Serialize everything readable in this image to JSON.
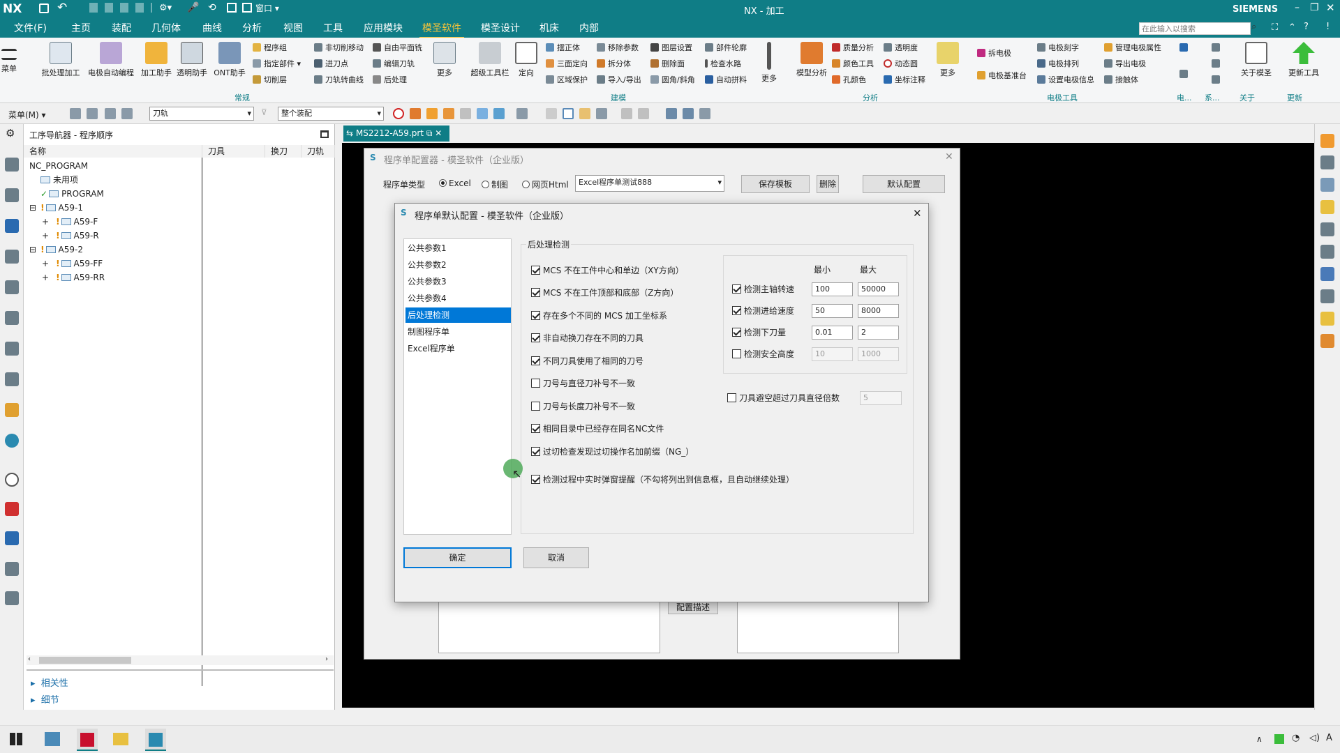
{
  "titlebar": {
    "logo": "NX",
    "title": "NX - 加工",
    "brand": "SIEMENS"
  },
  "menu": {
    "items": [
      "文件(F)",
      "主页",
      "装配",
      "几何体",
      "曲线",
      "分析",
      "视图",
      "工具",
      "应用模块",
      "模圣软件",
      "模圣设计",
      "机床",
      "内部"
    ],
    "active": "模圣软件",
    "search_placeholder": "在此输入以搜索"
  },
  "ribbon": {
    "big": [
      "批处理加工",
      "电极自动编程",
      "加工助手",
      "透明助手",
      "ONT助手"
    ],
    "left_small": [
      [
        "程序组",
        "非切削移动",
        "自由平面铣"
      ],
      [
        "指定部件",
        "进刀点",
        "编辑刀轨"
      ],
      [
        "切削层",
        "刀轨转曲线",
        "后处理"
      ]
    ],
    "mid_small": [
      [
        "摆正体",
        "移除参数",
        "图层设置",
        "部件轮廓"
      ],
      [
        "三面定向",
        "拆分体",
        "删除面",
        "检查水路"
      ],
      [
        "区域保护",
        "导入/导出",
        "圆角/斜角",
        "自动拼料"
      ]
    ],
    "mid_big": [
      "更多",
      "超级工具栏",
      "定向"
    ],
    "analysis_big": "模型分析",
    "analysis_small": [
      [
        "质量分析",
        "透明度"
      ],
      [
        "颜色工具",
        "动态圆"
      ],
      [
        "孔颜色",
        "坐标注释"
      ]
    ],
    "electrode_big": "拆电极",
    "electrode_base": "电极基准台",
    "electrode_small": [
      [
        "电极刻字",
        "管理电极属性"
      ],
      [
        "电极排列",
        "导出电极"
      ],
      [
        "设置电极信息",
        "接触体"
      ]
    ],
    "extra": [
      "关于模圣",
      "更新工具"
    ],
    "groups": [
      "常规",
      "建模",
      "分析",
      "电极工具",
      "电...",
      "系...",
      "关于",
      "更新"
    ],
    "more": "更多",
    "menu_btn": "菜单"
  },
  "toolbar2": {
    "menu": "菜单(M)",
    "filter": "刀轨",
    "assembly": "整个装配"
  },
  "nav": {
    "title": "工序导航器 - 程序顺序",
    "cols": [
      "名称",
      "刀具",
      "换刀",
      "刀轨"
    ],
    "tree": [
      {
        "label": "NC_PROGRAM",
        "level": 0
      },
      {
        "label": "未用项",
        "level": 1
      },
      {
        "label": "PROGRAM",
        "level": 1
      },
      {
        "label": "A59-1",
        "level": 1
      },
      {
        "label": "A59-F",
        "level": 2
      },
      {
        "label": "A59-R",
        "level": 2
      },
      {
        "label": "A59-2",
        "level": 1
      },
      {
        "label": "A59-FF",
        "level": 2
      },
      {
        "label": "A59-RR",
        "level": 2
      }
    ],
    "bottom": [
      "相关性",
      "细节"
    ]
  },
  "tab": {
    "label": "MS2212-A59.prt"
  },
  "cfg": {
    "title": "程序单配置器 - 模圣软件（企业版）",
    "type_label": "程序单类型",
    "radios": [
      "Excel",
      "制图",
      "网页Html"
    ],
    "selected": "Excel",
    "template": "Excel程序单测试888",
    "buttons": [
      "保存模板",
      "删除",
      "默认配置"
    ],
    "desc_btn": "配置描述"
  },
  "dlg": {
    "title": "程序单默认配置 - 模圣软件（企业版）",
    "list": [
      "公共参数1",
      "公共参数2",
      "公共参数3",
      "公共参数4",
      "后处理检测",
      "制图程序单",
      "Excel程序单"
    ],
    "selected": "后处理检测",
    "section": "后处理检测",
    "checks": [
      {
        "label": "MCS 不在工件中心和单边（XY方向）",
        "on": true
      },
      {
        "label": "MCS 不在工件顶部和底部（Z方向）",
        "on": true
      },
      {
        "label": "存在多个不同的 MCS 加工坐标系",
        "on": true
      },
      {
        "label": "非自动换刀存在不同的刀具",
        "on": true
      },
      {
        "label": "不同刀具使用了相同的刀号",
        "on": true
      },
      {
        "label": "刀号与直径刀补号不一致",
        "on": false
      },
      {
        "label": "刀号与长度刀补号不一致",
        "on": false
      },
      {
        "label": "相同目录中已经存在同名NC文件",
        "on": true
      },
      {
        "label": "过切检查发现过切操作名加前缀（NG_）",
        "on": true
      },
      {
        "label": "检测过程中实时弹窗提醒（不勾将列出到信息框，且自动继续处理）",
        "on": true
      }
    ],
    "min_label": "最小",
    "max_label": "最大",
    "ranges": [
      {
        "label": "检测主轴转速",
        "on": true,
        "min": "100",
        "max": "50000"
      },
      {
        "label": "检测进给速度",
        "on": true,
        "min": "50",
        "max": "8000"
      },
      {
        "label": "检测下刀量",
        "on": true,
        "min": "0.01",
        "max": "2"
      },
      {
        "label": "检测安全高度",
        "on": false,
        "min": "10",
        "max": "1000"
      }
    ],
    "exceed": {
      "label": "刀具避空超过刀具直径倍数",
      "on": false,
      "value": "5"
    },
    "ok": "确定",
    "cancel": "取消"
  }
}
